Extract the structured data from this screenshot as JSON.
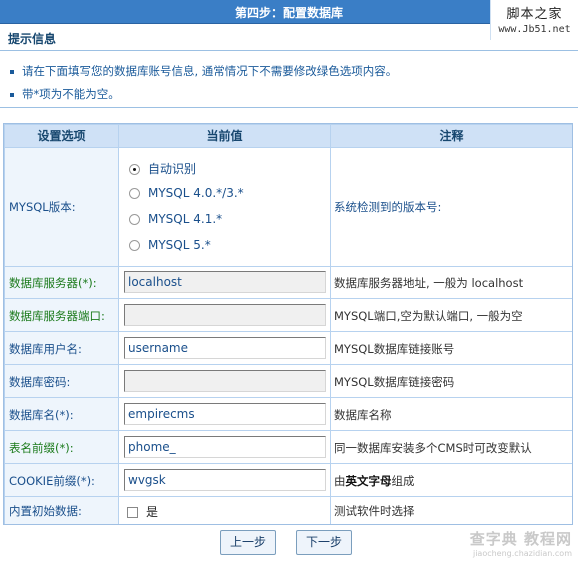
{
  "title": "第四步：配置数据库",
  "site_logo": {
    "line1": "脚本之家",
    "line2": "www.Jb51.net"
  },
  "tips": {
    "heading": "提示信息",
    "items": [
      "请在下面填写您的数据库账号信息, 通常情况下不需要修改绿色选项内容。",
      "带*项为不能为空。"
    ]
  },
  "table": {
    "headers": [
      "设置选项",
      "当前值",
      "注释"
    ],
    "mysql_version": {
      "label": "MYSQL版本:",
      "options": [
        "自动识别",
        "MYSQL 4.0.*/3.*",
        "MYSQL 4.1.*",
        "MYSQL 5.*"
      ],
      "selected": "自动识别",
      "note": "系统检测到的版本号:"
    },
    "rows": [
      {
        "label": "数据库服务器(*):",
        "value": "localhost",
        "note": "数据库服务器地址, 一般为  localhost"
      },
      {
        "label": "数据库服务器端口:",
        "value": "",
        "note": "MYSQL端口,空为默认端口, 一般为空"
      },
      {
        "label": "数据库用户名:",
        "value": "username",
        "note": "MYSQL数据库链接账号"
      },
      {
        "label": "数据库密码:",
        "value": "",
        "note": "MYSQL数据库链接密码"
      },
      {
        "label": "数据库名(*):",
        "value": "empirecms",
        "note": "数据库名称"
      },
      {
        "label": "表名前缀(*):",
        "value": "phome_",
        "note": "同一数据库安装多个CMS时可改变默认"
      },
      {
        "label": "COOKIE前缀(*):",
        "value": "wvgsk",
        "note_prefix": "由",
        "note_bold": "英文字母",
        "note_suffix": "组成"
      }
    ],
    "init_data": {
      "label": "内置初始数据:",
      "checkbox_label": "是",
      "checked": false,
      "note": "测试软件时选择"
    }
  },
  "buttons": {
    "prev": "上一步",
    "next": "下一步"
  },
  "watermark": {
    "line1": "查字典 教程网",
    "line2": "jiaocheng.chazidian.com"
  },
  "colors": {
    "title_bar": "#3a7ec6",
    "grid_border": "#b7d2ef",
    "header_bg": "#cfe1f6",
    "green_label": "#1b7a1b",
    "blue_label": "#1a4f8b"
  }
}
